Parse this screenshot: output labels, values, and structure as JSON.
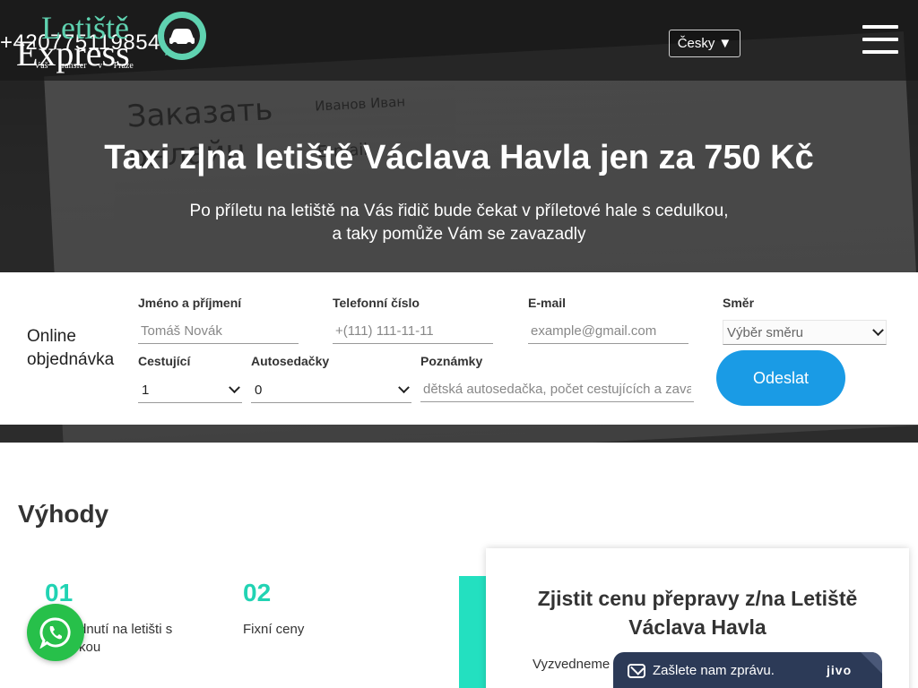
{
  "header": {
    "phone": "+420775119854",
    "logo": {
      "line1": "Letiště",
      "line2": "Express",
      "tagline": "Váš transfer v Praze"
    },
    "language": "Česky",
    "language_arrow": "▼"
  },
  "hero": {
    "title": "Taxi z|na letiště Václava Havla jen za 750 Kč",
    "subtitle_line1": "Po příletu na letiště na Vás řidič bude čekat v příletové hale s cedulkou,",
    "subtitle_line2": "a taky pomůže Vám se zavazadly"
  },
  "order": {
    "title": "Online objednávka",
    "name_label": "Jméno a příjmení",
    "name_placeholder": "Tomáš Novák",
    "phone_label": "Telefonní číslo",
    "phone_placeholder": "+(111) 111-11-11",
    "email_label": "E-mail",
    "email_placeholder": "example@gmail.com",
    "direction_label": "Směr",
    "direction_value": "Výběr směru",
    "passengers_label": "Cestující",
    "passengers_value": "1",
    "seats_label": "Autosedačky",
    "seats_value": "0",
    "notes_label": "Poznámky",
    "notes_placeholder": "dětská autosedačka, počet cestujících a zava",
    "submit_label": "Odeslat"
  },
  "benefits": {
    "title": "Výhody",
    "items": [
      {
        "num": "01",
        "text_line1": "dnutí na letišti s",
        "text_line2": "kou"
      },
      {
        "num": "02",
        "text_line1": "Fixní ceny",
        "text_line2": ""
      }
    ]
  },
  "price_card": {
    "title_line1": "Zjistit cenu přepravy z/na Letiště",
    "title_line2": "Václava Havla",
    "pickup_label": "Vyzvedneme"
  },
  "chat": {
    "text": "Zašlete nam zprávu.",
    "brand": "jivo"
  },
  "colors": {
    "accent": "#21d3b3",
    "button": "#1a9be5",
    "whatsapp": "#27c04a",
    "chat": "#2c3a57"
  }
}
